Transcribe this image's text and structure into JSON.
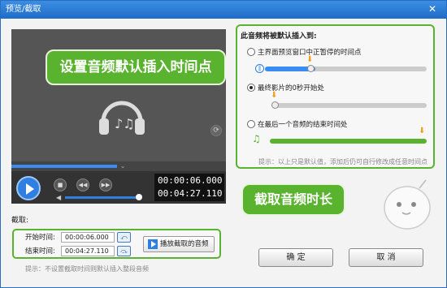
{
  "window": {
    "title": "预览/截取",
    "close_glyph": "✕"
  },
  "preview": {
    "overlay_label": "设置音频默认插入时间点",
    "current_time": "00:00:06.000",
    "total_time": "00:04:27.110",
    "seek_progress": 0.5,
    "volume_level": 0.95,
    "play_icon": "play-icon",
    "stop_icon": "stop-icon",
    "prev_icon": "prev-icon",
    "next_icon": "next-icon"
  },
  "insert_panel": {
    "title": "此音频将被默认插入到:",
    "options": [
      {
        "label": "主界面预览窗口中正暂停的时间点",
        "selected": false,
        "slider_level": 0.35
      },
      {
        "label": "最终影片的0秒开始处",
        "selected": true,
        "slider_level": 0.0
      },
      {
        "label": "在最后一个音频的结束时间处",
        "selected": false,
        "slider_level": 1.0
      }
    ],
    "hint": "提示：以上只是默认值，添加后仍可自行修改成任意时间点"
  },
  "crop": {
    "section_label": "截取:",
    "callout_label": "截取音频时长",
    "start_label": "开始时间:",
    "start_value": "00:00:06.000",
    "end_label": "结束时间:",
    "end_value": "00:04:27.110",
    "play_button_label": "播放截取的音频",
    "hint": "提示：不设置截取时间则默认插入整段音频"
  },
  "buttons": {
    "ok": "确 定",
    "cancel": "取 消"
  },
  "colors": {
    "accent_green": "#5ab32e",
    "accent_blue": "#2f7fe0",
    "title_blue": "#1e6cc8"
  }
}
